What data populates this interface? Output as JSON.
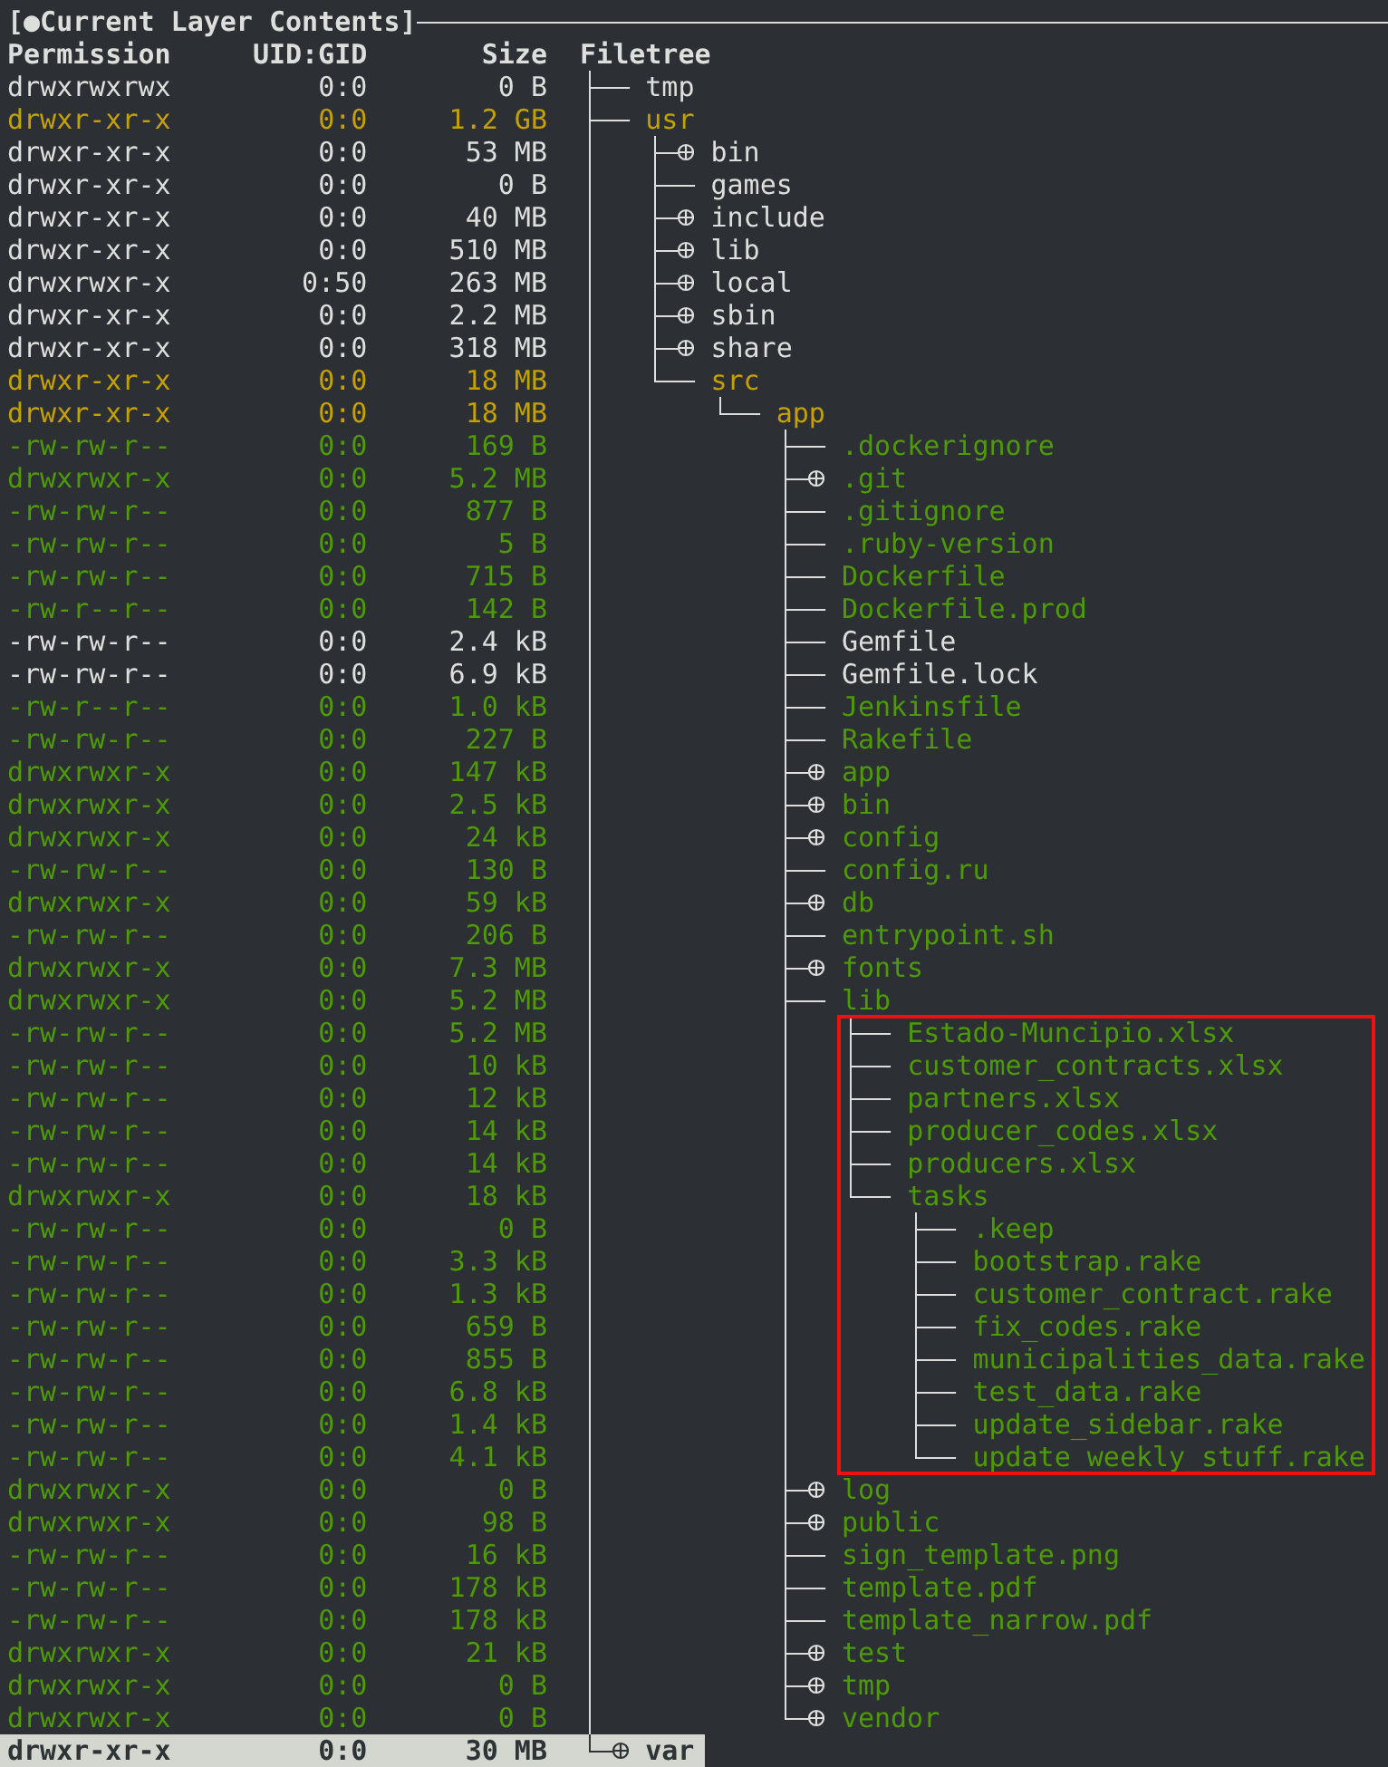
{
  "header": {
    "title": "[●Current Layer Contents]"
  },
  "columns": [
    "Permission",
    "UID:GID",
    "Size",
    "Filetree"
  ],
  "tree": [
    {
      "name": "tmp",
      "permission": "drwxrwxrwx",
      "uid_gid": "0:0",
      "size": "0 B",
      "color": "#dcdfdb",
      "collapsed": false,
      "selected": false
    },
    {
      "name": "usr",
      "permission": "drwxr-xr-x",
      "uid_gid": "0:0",
      "size": "1.2 GB",
      "color": "#c4a000",
      "collapsed": false,
      "selected": false,
      "children": [
        {
          "name": "bin",
          "permission": "drwxr-xr-x",
          "uid_gid": "0:0",
          "size": "53 MB",
          "color": "#dcdfdb",
          "collapsed": true,
          "selected": false
        },
        {
          "name": "games",
          "permission": "drwxr-xr-x",
          "uid_gid": "0:0",
          "size": "0 B",
          "color": "#dcdfdb",
          "collapsed": false,
          "selected": false
        },
        {
          "name": "include",
          "permission": "drwxr-xr-x",
          "uid_gid": "0:0",
          "size": "40 MB",
          "color": "#dcdfdb",
          "collapsed": true,
          "selected": false
        },
        {
          "name": "lib",
          "permission": "drwxr-xr-x",
          "uid_gid": "0:0",
          "size": "510 MB",
          "color": "#dcdfdb",
          "collapsed": true,
          "selected": false
        },
        {
          "name": "local",
          "permission": "drwxrwxr-x",
          "uid_gid": "0:50",
          "size": "263 MB",
          "color": "#dcdfdb",
          "collapsed": true,
          "selected": false
        },
        {
          "name": "sbin",
          "permission": "drwxr-xr-x",
          "uid_gid": "0:0",
          "size": "2.2 MB",
          "color": "#dcdfdb",
          "collapsed": true,
          "selected": false
        },
        {
          "name": "share",
          "permission": "drwxr-xr-x",
          "uid_gid": "0:0",
          "size": "318 MB",
          "color": "#dcdfdb",
          "collapsed": true,
          "selected": false
        },
        {
          "name": "src",
          "permission": "drwxr-xr-x",
          "uid_gid": "0:0",
          "size": "18 MB",
          "color": "#c4a000",
          "collapsed": false,
          "selected": false,
          "children": [
            {
              "name": "app",
              "permission": "drwxr-xr-x",
              "uid_gid": "0:0",
              "size": "18 MB",
              "color": "#c4a000",
              "collapsed": false,
              "selected": false,
              "children": [
                {
                  "name": ".dockerignore",
                  "permission": "-rw-rw-r--",
                  "uid_gid": "0:0",
                  "size": "169 B",
                  "color": "#4e9a06",
                  "collapsed": false,
                  "selected": false
                },
                {
                  "name": ".git",
                  "permission": "drwxrwxr-x",
                  "uid_gid": "0:0",
                  "size": "5.2 MB",
                  "color": "#4e9a06",
                  "collapsed": true,
                  "selected": false
                },
                {
                  "name": ".gitignore",
                  "permission": "-rw-rw-r--",
                  "uid_gid": "0:0",
                  "size": "877 B",
                  "color": "#4e9a06",
                  "collapsed": false,
                  "selected": false
                },
                {
                  "name": ".ruby-version",
                  "permission": "-rw-rw-r--",
                  "uid_gid": "0:0",
                  "size": "5 B",
                  "color": "#4e9a06",
                  "collapsed": false,
                  "selected": false
                },
                {
                  "name": "Dockerfile",
                  "permission": "-rw-rw-r--",
                  "uid_gid": "0:0",
                  "size": "715 B",
                  "color": "#4e9a06",
                  "collapsed": false,
                  "selected": false
                },
                {
                  "name": "Dockerfile.prod",
                  "permission": "-rw-r--r--",
                  "uid_gid": "0:0",
                  "size": "142 B",
                  "color": "#4e9a06",
                  "collapsed": false,
                  "selected": false
                },
                {
                  "name": "Gemfile",
                  "permission": "-rw-rw-r--",
                  "uid_gid": "0:0",
                  "size": "2.4 kB",
                  "color": "#dcdfdb",
                  "collapsed": false,
                  "selected": false
                },
                {
                  "name": "Gemfile.lock",
                  "permission": "-rw-rw-r--",
                  "uid_gid": "0:0",
                  "size": "6.9 kB",
                  "color": "#dcdfdb",
                  "collapsed": false,
                  "selected": false
                },
                {
                  "name": "Jenkinsfile",
                  "permission": "-rw-r--r--",
                  "uid_gid": "0:0",
                  "size": "1.0 kB",
                  "color": "#4e9a06",
                  "collapsed": false,
                  "selected": false
                },
                {
                  "name": "Rakefile",
                  "permission": "-rw-rw-r--",
                  "uid_gid": "0:0",
                  "size": "227 B",
                  "color": "#4e9a06",
                  "collapsed": false,
                  "selected": false
                },
                {
                  "name": "app",
                  "permission": "drwxrwxr-x",
                  "uid_gid": "0:0",
                  "size": "147 kB",
                  "color": "#4e9a06",
                  "collapsed": true,
                  "selected": false
                },
                {
                  "name": "bin",
                  "permission": "drwxrwxr-x",
                  "uid_gid": "0:0",
                  "size": "2.5 kB",
                  "color": "#4e9a06",
                  "collapsed": true,
                  "selected": false
                },
                {
                  "name": "config",
                  "permission": "drwxrwxr-x",
                  "uid_gid": "0:0",
                  "size": "24 kB",
                  "color": "#4e9a06",
                  "collapsed": true,
                  "selected": false
                },
                {
                  "name": "config.ru",
                  "permission": "-rw-rw-r--",
                  "uid_gid": "0:0",
                  "size": "130 B",
                  "color": "#4e9a06",
                  "collapsed": false,
                  "selected": false
                },
                {
                  "name": "db",
                  "permission": "drwxrwxr-x",
                  "uid_gid": "0:0",
                  "size": "59 kB",
                  "color": "#4e9a06",
                  "collapsed": true,
                  "selected": false
                },
                {
                  "name": "entrypoint.sh",
                  "permission": "-rw-rw-r--",
                  "uid_gid": "0:0",
                  "size": "206 B",
                  "color": "#4e9a06",
                  "collapsed": false,
                  "selected": false
                },
                {
                  "name": "fonts",
                  "permission": "drwxrwxr-x",
                  "uid_gid": "0:0",
                  "size": "7.3 MB",
                  "color": "#4e9a06",
                  "collapsed": true,
                  "selected": false
                },
                {
                  "name": "lib",
                  "permission": "drwxrwxr-x",
                  "uid_gid": "0:0",
                  "size": "5.2 MB",
                  "color": "#4e9a06",
                  "collapsed": false,
                  "selected": false,
                  "annotated": true,
                  "children": [
                    {
                      "name": "Estado-Muncipio.xlsx",
                      "permission": "-rw-rw-r--",
                      "uid_gid": "0:0",
                      "size": "5.2 MB",
                      "color": "#4e9a06",
                      "collapsed": false,
                      "selected": false
                    },
                    {
                      "name": "customer_contracts.xlsx",
                      "permission": "-rw-rw-r--",
                      "uid_gid": "0:0",
                      "size": "10 kB",
                      "color": "#4e9a06",
                      "collapsed": false,
                      "selected": false
                    },
                    {
                      "name": "partners.xlsx",
                      "permission": "-rw-rw-r--",
                      "uid_gid": "0:0",
                      "size": "12 kB",
                      "color": "#4e9a06",
                      "collapsed": false,
                      "selected": false
                    },
                    {
                      "name": "producer_codes.xlsx",
                      "permission": "-rw-rw-r--",
                      "uid_gid": "0:0",
                      "size": "14 kB",
                      "color": "#4e9a06",
                      "collapsed": false,
                      "selected": false
                    },
                    {
                      "name": "producers.xlsx",
                      "permission": "-rw-rw-r--",
                      "uid_gid": "0:0",
                      "size": "14 kB",
                      "color": "#4e9a06",
                      "collapsed": false,
                      "selected": false
                    },
                    {
                      "name": "tasks",
                      "permission": "drwxrwxr-x",
                      "uid_gid": "0:0",
                      "size": "18 kB",
                      "color": "#4e9a06",
                      "collapsed": false,
                      "selected": false,
                      "children": [
                        {
                          "name": ".keep",
                          "permission": "-rw-rw-r--",
                          "uid_gid": "0:0",
                          "size": "0 B",
                          "color": "#4e9a06",
                          "collapsed": false,
                          "selected": false
                        },
                        {
                          "name": "bootstrap.rake",
                          "permission": "-rw-rw-r--",
                          "uid_gid": "0:0",
                          "size": "3.3 kB",
                          "color": "#4e9a06",
                          "collapsed": false,
                          "selected": false
                        },
                        {
                          "name": "customer_contract.rake",
                          "permission": "-rw-rw-r--",
                          "uid_gid": "0:0",
                          "size": "1.3 kB",
                          "color": "#4e9a06",
                          "collapsed": false,
                          "selected": false
                        },
                        {
                          "name": "fix_codes.rake",
                          "permission": "-rw-rw-r--",
                          "uid_gid": "0:0",
                          "size": "659 B",
                          "color": "#4e9a06",
                          "collapsed": false,
                          "selected": false
                        },
                        {
                          "name": "municipalities_data.rake",
                          "permission": "-rw-rw-r--",
                          "uid_gid": "0:0",
                          "size": "855 B",
                          "color": "#4e9a06",
                          "collapsed": false,
                          "selected": false
                        },
                        {
                          "name": "test_data.rake",
                          "permission": "-rw-rw-r--",
                          "uid_gid": "0:0",
                          "size": "6.8 kB",
                          "color": "#4e9a06",
                          "collapsed": false,
                          "selected": false
                        },
                        {
                          "name": "update_sidebar.rake",
                          "permission": "-rw-rw-r--",
                          "uid_gid": "0:0",
                          "size": "1.4 kB",
                          "color": "#4e9a06",
                          "collapsed": false,
                          "selected": false
                        },
                        {
                          "name": "update_weekly_stuff.rake",
                          "permission": "-rw-rw-r--",
                          "uid_gid": "0:0",
                          "size": "4.1 kB",
                          "color": "#4e9a06",
                          "collapsed": false,
                          "selected": false
                        }
                      ]
                    }
                  ]
                },
                {
                  "name": "log",
                  "permission": "drwxrwxr-x",
                  "uid_gid": "0:0",
                  "size": "0 B",
                  "color": "#4e9a06",
                  "collapsed": true,
                  "selected": false
                },
                {
                  "name": "public",
                  "permission": "drwxrwxr-x",
                  "uid_gid": "0:0",
                  "size": "98 B",
                  "color": "#4e9a06",
                  "collapsed": true,
                  "selected": false
                },
                {
                  "name": "sign_template.png",
                  "permission": "-rw-rw-r--",
                  "uid_gid": "0:0",
                  "size": "16 kB",
                  "color": "#4e9a06",
                  "collapsed": false,
                  "selected": false
                },
                {
                  "name": "template.pdf",
                  "permission": "-rw-rw-r--",
                  "uid_gid": "0:0",
                  "size": "178 kB",
                  "color": "#4e9a06",
                  "collapsed": false,
                  "selected": false
                },
                {
                  "name": "template_narrow.pdf",
                  "permission": "-rw-rw-r--",
                  "uid_gid": "0:0",
                  "size": "178 kB",
                  "color": "#4e9a06",
                  "collapsed": false,
                  "selected": false
                },
                {
                  "name": "test",
                  "permission": "drwxrwxr-x",
                  "uid_gid": "0:0",
                  "size": "21 kB",
                  "color": "#4e9a06",
                  "collapsed": true,
                  "selected": false
                },
                {
                  "name": "tmp",
                  "permission": "drwxrwxr-x",
                  "uid_gid": "0:0",
                  "size": "0 B",
                  "color": "#4e9a06",
                  "collapsed": true,
                  "selected": false
                },
                {
                  "name": "vendor",
                  "permission": "drwxrwxr-x",
                  "uid_gid": "0:0",
                  "size": "0 B",
                  "color": "#4e9a06",
                  "collapsed": true,
                  "selected": false
                }
              ]
            }
          ]
        }
      ]
    },
    {
      "name": "var",
      "permission": "drwxr-xr-x",
      "uid_gid": "0:0",
      "size": "30 MB",
      "collapsed": true,
      "selected": true
    }
  ]
}
